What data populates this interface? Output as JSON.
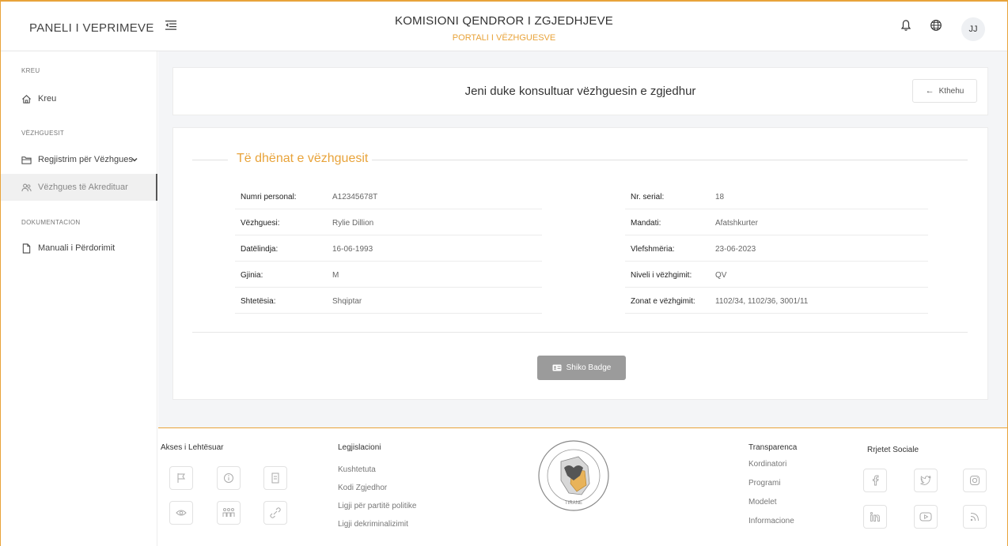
{
  "header": {
    "brand": "PANELI I VEPRIMEVE",
    "title": "KOMISIONI QENDROR I ZGJEDHJEVE",
    "subtitle": "PORTALI I VËZHGUESVE",
    "avatar_initials": "JJ",
    "icons": [
      "bell-icon",
      "globe-icon",
      "menu-toggle-icon"
    ]
  },
  "sidebar": {
    "sections": [
      {
        "label": "KREU"
      },
      {
        "label": "VËZHGUESIT"
      },
      {
        "label": "DOKUMENTACION"
      }
    ],
    "items": [
      {
        "label": "Kreu",
        "icon": "home-icon"
      },
      {
        "label": "Regjistrim për Vëzhgues",
        "icon": "folder-icon"
      },
      {
        "label": "Vëzhgues të Akredituar",
        "icon": "users-icon"
      },
      {
        "label": "Manuali i Përdorimit",
        "icon": "document-icon"
      }
    ]
  },
  "main": {
    "top_title": "Jeni duke konsultuar vëzhguesin e zgjedhur",
    "back_label": "Kthehu",
    "section_title": "Të dhënat e vëzhguesit",
    "left_fields": [
      {
        "label": "Numri personal:",
        "value": "A12345678T"
      },
      {
        "label": "Vëzhguesi:",
        "value": "Rylie Dillion"
      },
      {
        "label": "Datëlindja:",
        "value": "16-06-1993"
      },
      {
        "label": "Gjinia:",
        "value": "M"
      },
      {
        "label": "Shtetësia:",
        "value": "Shqiptar"
      }
    ],
    "right_fields": [
      {
        "label": "Nr. serial:",
        "value": "18"
      },
      {
        "label": "Mandati:",
        "value": "Afatshkurter"
      },
      {
        "label": "Vlefshmëria:",
        "value": "23-06-2023"
      },
      {
        "label": "Niveli i vëzhgimit:",
        "value": "QV"
      },
      {
        "label": "Zonat e vëzhgimit:",
        "value": "1102/34, 1102/36, 3001/11"
      }
    ],
    "badge_button": "Shiko Badge"
  },
  "footer": {
    "accessibility": {
      "title": "Akses i Lehtësuar",
      "icons": [
        "flag-icon",
        "info-icon",
        "document-icon",
        "eye-icon",
        "people-icon",
        "link-icon"
      ]
    },
    "legislation": {
      "title": "Legjislacioni",
      "links": [
        "Kushtetuta",
        "Kodi Zgjedhor",
        "Ligji për partitë politike",
        "Ligji dekriminalizimit"
      ]
    },
    "seal_text": "TIRANE",
    "transparency": {
      "title": "Transparenca",
      "links": [
        "Kordinatori",
        "Programi",
        "Modelet",
        "Informacione"
      ]
    },
    "social": {
      "title": "Rrjetet Sociale",
      "icons": [
        "facebook-icon",
        "twitter-icon",
        "instagram-icon",
        "linkedin-icon",
        "youtube-icon",
        "rss-icon"
      ]
    }
  },
  "colors": {
    "accent": "#e8a33a",
    "button_gray": "#9b9b9b",
    "background": "#f4f5f7"
  }
}
